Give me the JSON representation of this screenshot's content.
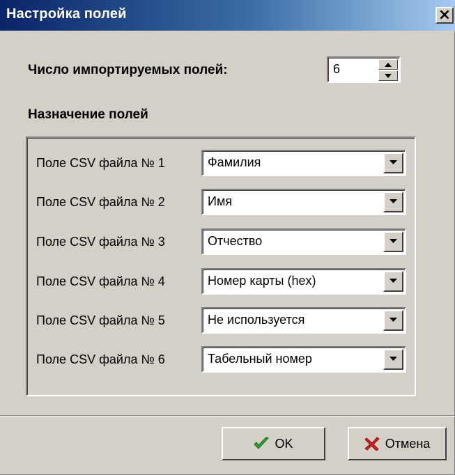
{
  "window": {
    "title": "Настройка полей",
    "close_glyph": "×"
  },
  "import_count": {
    "label": "Число импортируемых полей:",
    "value": "6"
  },
  "assignment": {
    "heading": "Назначение полей",
    "rows": [
      {
        "label": "Поле CSV файла № 1",
        "value": "Фамилия"
      },
      {
        "label": "Поле CSV файла № 2",
        "value": "Имя"
      },
      {
        "label": "Поле CSV файла № 3",
        "value": "Отчество"
      },
      {
        "label": "Поле CSV файла № 4",
        "value": "Номер карты (hex)"
      },
      {
        "label": "Поле CSV файла № 5",
        "value": "Не используется"
      },
      {
        "label": "Поле CSV файла № 6",
        "value": "Табельный номер"
      }
    ]
  },
  "buttons": {
    "ok_label": "OK",
    "ok_icon": "checkmark-icon",
    "cancel_label": "Отмена",
    "cancel_icon": "cross-icon"
  },
  "colors": {
    "title_start": "#0a246a",
    "title_end": "#a6caf0",
    "face": "#d4d0c8",
    "ok_green": "#2fa12f",
    "cancel_red": "#d42020"
  }
}
